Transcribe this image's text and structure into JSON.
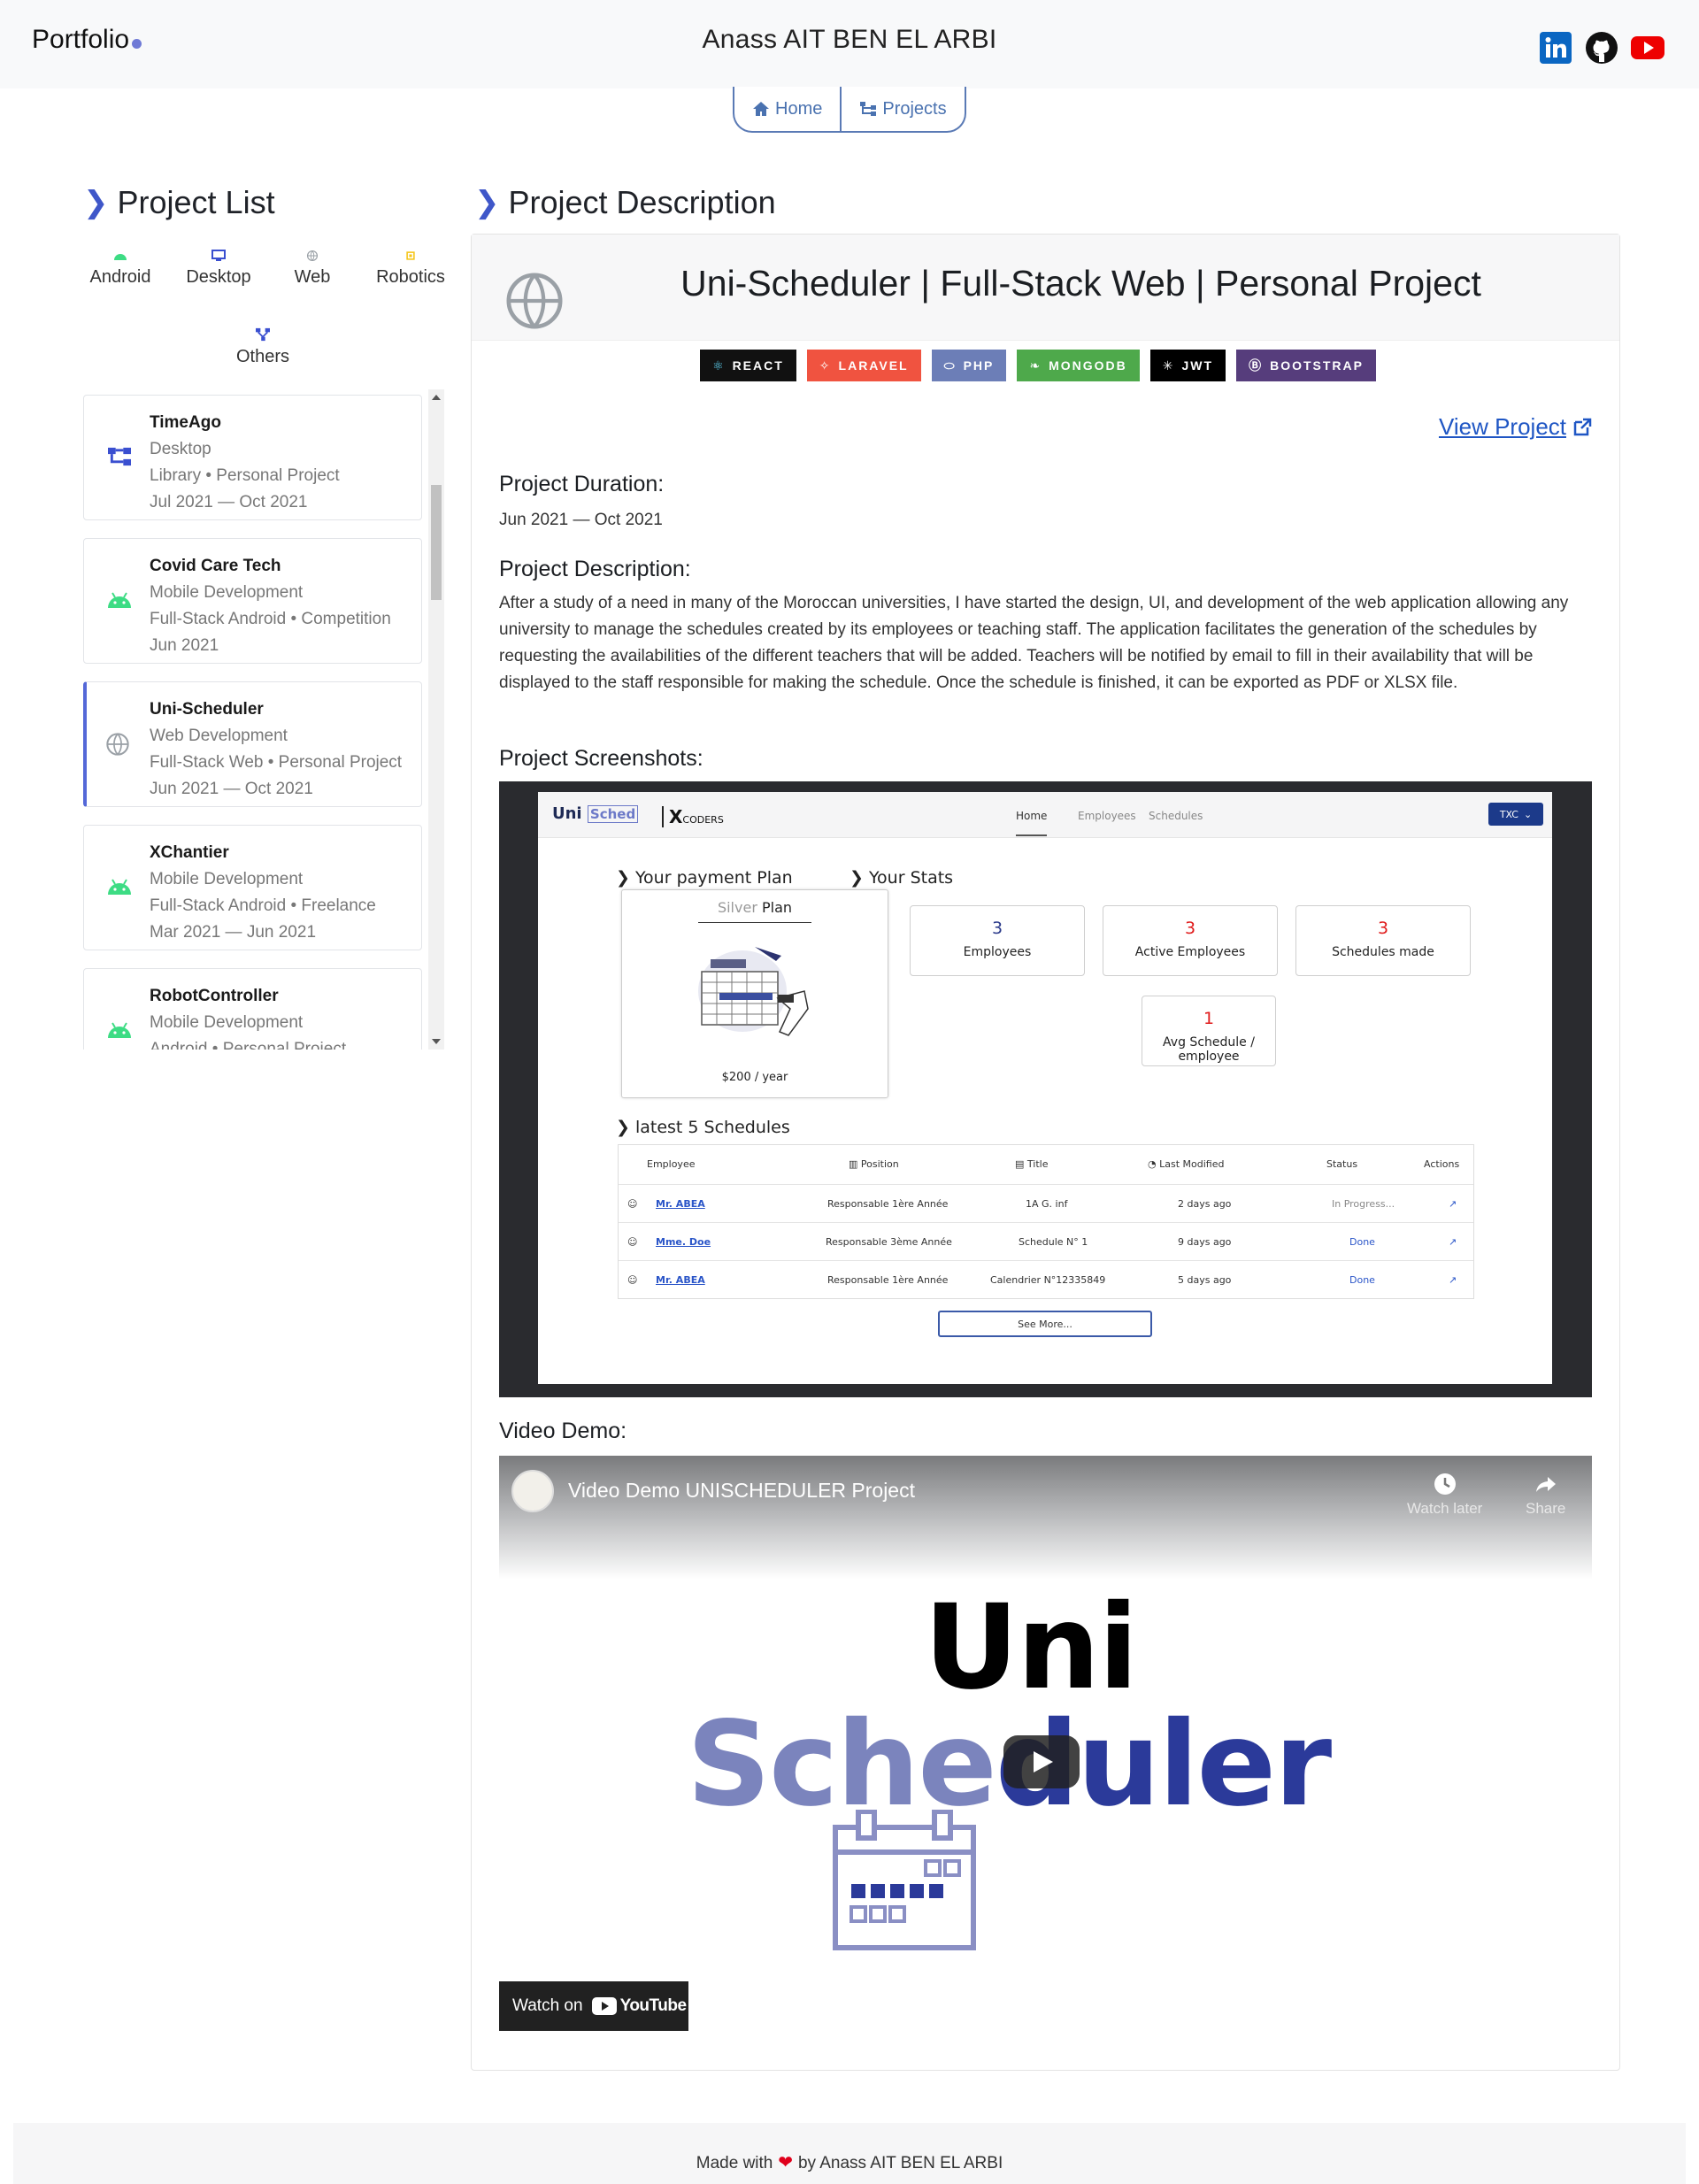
{
  "header": {
    "brand": "Portfolio",
    "site_name": "Anass AIT BEN EL ARBI",
    "social": [
      "linkedin-icon",
      "github-icon",
      "youtube-icon"
    ]
  },
  "nav": {
    "home": "Home",
    "projects": "Projects"
  },
  "sidebar": {
    "title": "Project List",
    "filters": [
      {
        "label": "Android",
        "icon": "android-icon",
        "color": "#3ddc84"
      },
      {
        "label": "Desktop",
        "icon": "monitor-icon",
        "color": "#3a4fd0"
      },
      {
        "label": "Web",
        "icon": "globe-icon",
        "color": "#9aa0a6"
      },
      {
        "label": "Robotics",
        "icon": "chip-icon",
        "color": "#f5c518"
      },
      {
        "label": "Others",
        "icon": "sitemap-icon",
        "color": "#3a4fd0"
      }
    ],
    "projects": [
      {
        "name": "TimeAgo",
        "category": "Desktop",
        "type": "Library • Personal Project",
        "dates": "Jul 2021 — Oct 2021"
      },
      {
        "name": "Covid Care Tech",
        "category": "Mobile Development",
        "type": "Full-Stack Android • Competition",
        "dates": "Jun 2021"
      },
      {
        "name": "Uni-Scheduler",
        "category": "Web Development",
        "type": "Full-Stack Web • Personal Project",
        "dates": "Jun 2021 — Oct 2021"
      },
      {
        "name": "XChantier",
        "category": "Mobile Development",
        "type": "Full-Stack Android • Freelance",
        "dates": "Mar 2021 — Jun 2021"
      },
      {
        "name": "RobotController",
        "category": "Mobile Development",
        "type": "Android • Personal Project",
        "dates": ""
      }
    ]
  },
  "main": {
    "title": "Project Description",
    "project_title": "Uni-Scheduler | Full-Stack Web | Personal Project",
    "badges": [
      {
        "label": "REACT",
        "bg": "#111111",
        "icon": "react-icon"
      },
      {
        "label": "LARAVEL",
        "bg": "#f05340",
        "icon": "laravel-icon"
      },
      {
        "label": "PHP",
        "bg": "#6c7eb7",
        "icon": "php-icon"
      },
      {
        "label": "MONGODB",
        "bg": "#4ea94b",
        "icon": "leaf-icon"
      },
      {
        "label": "JWT",
        "bg": "#000000",
        "icon": "jwt-icon"
      },
      {
        "label": "BOOTSTRAP",
        "bg": "#563d7c",
        "icon": "bootstrap-icon"
      }
    ],
    "view_project": "View Project",
    "duration_label": "Project Duration:",
    "duration": "Jun 2021 — Oct 2021",
    "description_label": "Project Description:",
    "description": "After a study of a need in many of the Moroccan universities, I have started the design, UI, and development of the web application allowing any university to manage the schedules created by its employees or teaching staff. The application facilitates the generation of the schedules by requesting the availabilities of the different teachers that will be added. Teachers will be notified by email to fill in their availability that will be displayed to the staff responsible for making the schedule. Once the schedule is finished, it can be exported as PDF or XLSX file.",
    "screenshots_label": "Project Screenshots:",
    "video_label": "Video Demo:"
  },
  "screenshot_app": {
    "logo_uni": "Uni",
    "logo_sched": "Sched",
    "logo_coders": "CODERS",
    "nav": [
      "Home",
      "Employees",
      "Schedules"
    ],
    "account": "TXC",
    "payment_title": "Your payment Plan",
    "plan_silver": "Silver",
    "plan_word": "Plan",
    "plan_price": "$200 / year",
    "stats_title": "Your Stats",
    "stats": [
      {
        "value": "3",
        "label": "Employees",
        "color": "#2b3a8a"
      },
      {
        "value": "3",
        "label": "Active Employees",
        "color": "#e01b1b"
      },
      {
        "value": "3",
        "label": "Schedules made",
        "color": "#e01b1b"
      },
      {
        "value": "1",
        "label": "Avg Schedule / employee",
        "color": "#e01b1b"
      }
    ],
    "latest_title": "latest 5 Schedules",
    "table_headers": [
      "Employee",
      "Position",
      "Title",
      "Last Modified",
      "Status",
      "Actions"
    ],
    "rows": [
      {
        "employee": "Mr. ABEA",
        "position": "Responsable 1ère Année",
        "title": "1A G. inf",
        "modified": "2 days ago",
        "status": "In Progress..."
      },
      {
        "employee": "Mme. Doe",
        "position": "Responsable 3ème Année",
        "title": "Schedule N° 1",
        "modified": "9 days ago",
        "status": "Done"
      },
      {
        "employee": "Mr. ABEA",
        "position": "Responsable 1ère Année",
        "title": "Calendrier N°12335849",
        "modified": "5 days ago",
        "status": "Done"
      }
    ],
    "see_more": "See More..."
  },
  "video": {
    "title": "Video Demo UNISCHEDULER Project",
    "watch_later": "Watch later",
    "share": "Share",
    "logo_uni": "Uni",
    "logo_sched_a": "Sche",
    "logo_sched_b": "duler",
    "watch_on": "Watch on",
    "youtube": "YouTube"
  },
  "footer": {
    "made_with": "Made with",
    "by": "by Anass AIT BEN EL ARBI"
  }
}
